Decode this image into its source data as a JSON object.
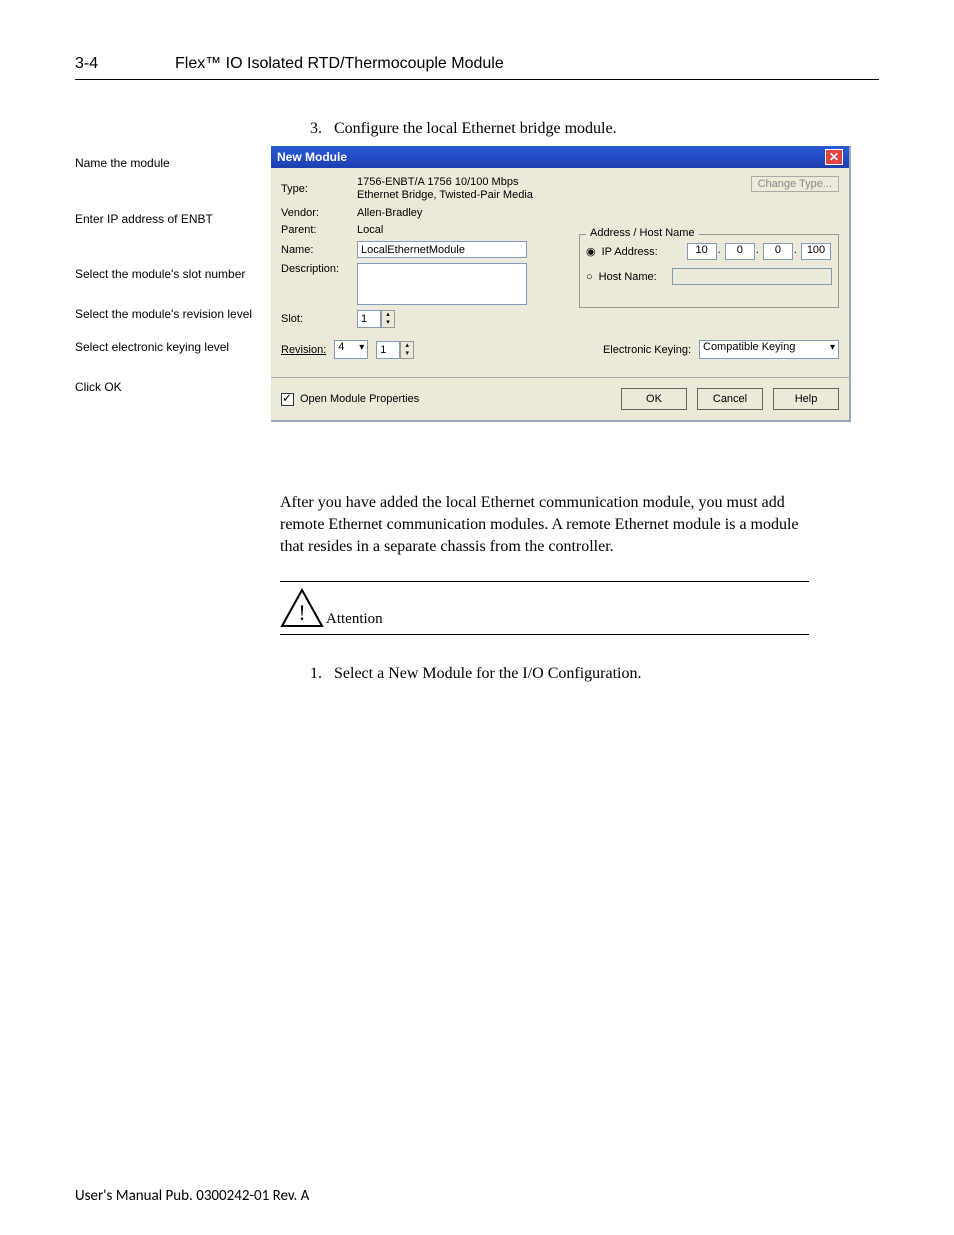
{
  "header": {
    "page_num": "3-4",
    "title": "Flex™ IO Isolated RTD/Thermocouple Module"
  },
  "step3_label": "3.",
  "step3_text": "Configure the local Ethernet bridge module.",
  "callouts": {
    "c1": "Name the module",
    "c2": "Enter IP address of ENBT",
    "c3": "Select the module's slot number",
    "c4": "Select the module's revision level",
    "c5": "Select electronic keying level",
    "c6": "Click OK"
  },
  "dialog": {
    "title": "New Module",
    "close_glyph": "✕",
    "labels": {
      "type": "Type:",
      "vendor": "Vendor:",
      "parent": "Parent:",
      "name": "Name:",
      "description": "Description:",
      "slot": "Slot:",
      "revision": "Revision:",
      "ek": "Electronic Keying:"
    },
    "values": {
      "type": "1756-ENBT/A 1756 10/100 Mbps Ethernet Bridge, Twisted-Pair Media",
      "vendor": "Allen-Bradley",
      "parent": "Local",
      "name": "LocalEthernetModule",
      "slot": "1",
      "rev_major": "4",
      "rev_minor": "1",
      "ek_value": "Compatible Keying"
    },
    "change_type_btn": "Change Type...",
    "addr_legend": "Address / Host Name",
    "ip_label": "IP Address:",
    "host_label": "Host Name:",
    "ip": {
      "o1": "10",
      "o2": "0",
      "o3": "0",
      "o4": "100"
    },
    "open_mod_props": "Open Module Properties",
    "ok": "OK",
    "cancel": "Cancel",
    "help": "Help"
  },
  "paragraph": "After you have added the local Ethernet communication module, you must add remote Ethernet communication modules. A remote Ethernet module is a module that resides in a separate chassis from the controller.",
  "attention": "Attention",
  "step1_label": "1.",
  "step1_text": "Select a New Module for the I/O Configuration.",
  "footer": "User's Manual Pub. 0300242-01 Rev. A"
}
